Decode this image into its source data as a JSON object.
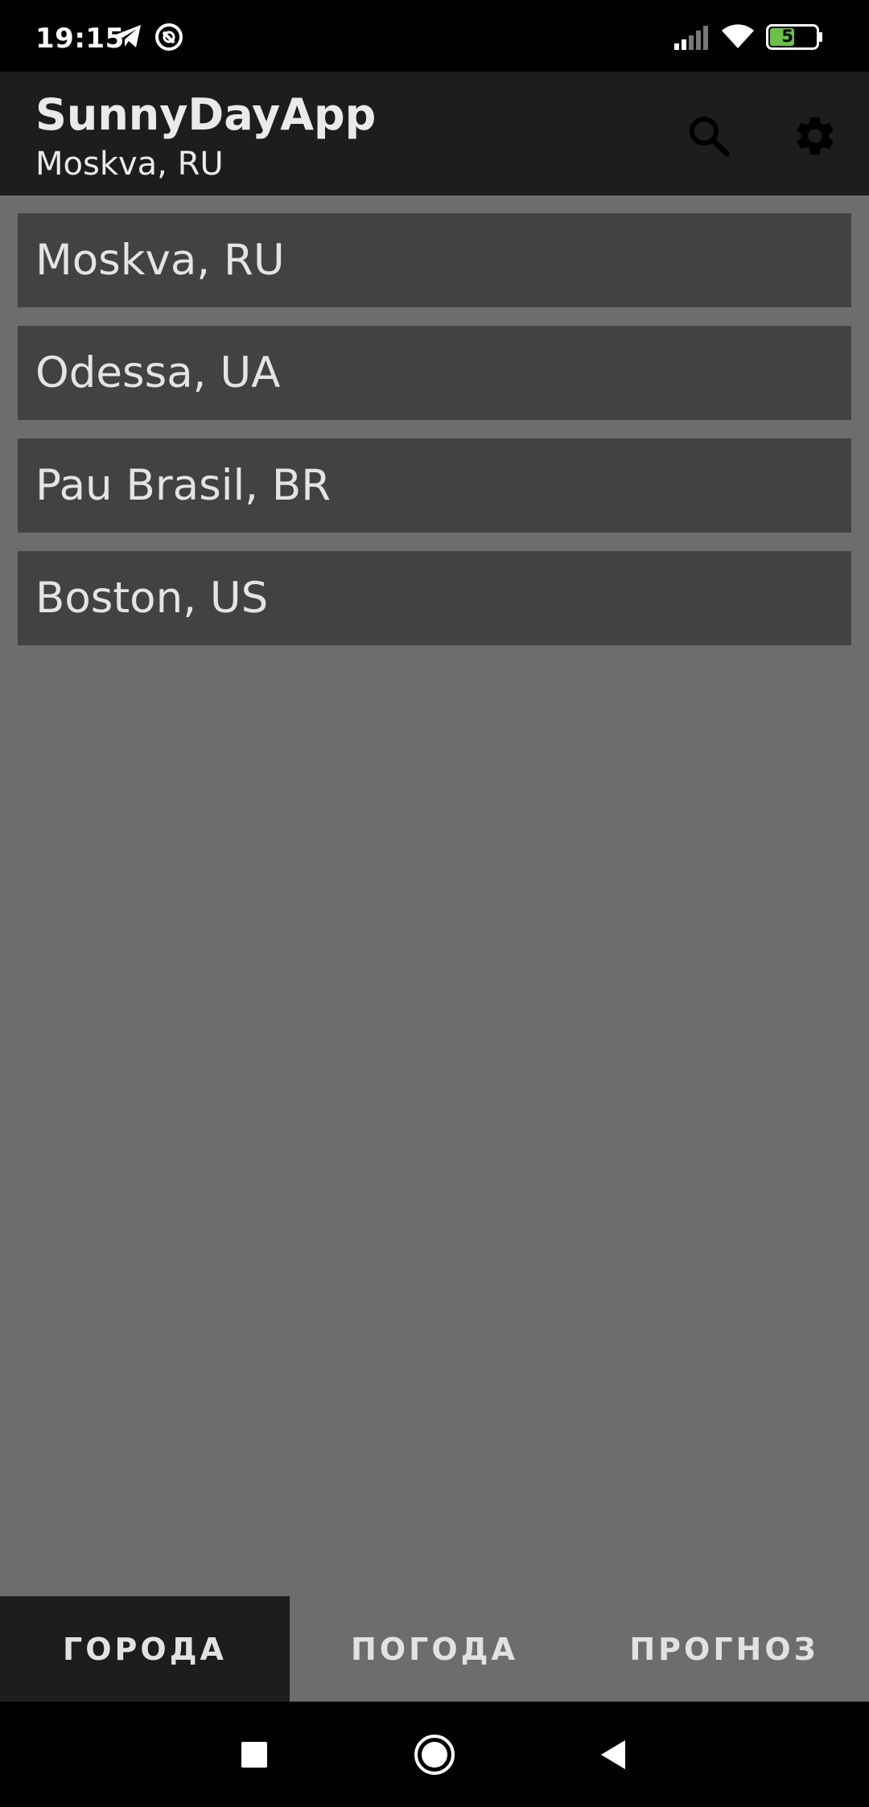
{
  "status_bar": {
    "time": "19:15",
    "left_icons": [
      "telegram-icon",
      "at-sign-icon"
    ],
    "right_icons": [
      "signal-icon",
      "wifi-icon",
      "battery-icon"
    ],
    "battery_level": "51"
  },
  "app_bar": {
    "title": "SunnyDayApp",
    "subtitle": "Moskva, RU",
    "actions": [
      "search-icon",
      "settings-icon"
    ]
  },
  "cities": [
    {
      "label": "Moskva, RU"
    },
    {
      "label": "Odessa, UA"
    },
    {
      "label": "Pau Brasil, BR"
    },
    {
      "label": "Boston, US"
    }
  ],
  "tabs": [
    {
      "label": "ГОРОДА",
      "active": true
    },
    {
      "label": "ПОГОДА",
      "active": false
    },
    {
      "label": "ПРОГНОЗ",
      "active": false
    }
  ],
  "nav_bar": {
    "buttons": [
      "recents-icon",
      "home-icon",
      "back-icon"
    ]
  },
  "colors": {
    "background": "#6d6d6d",
    "app_bar": "#1d1d1d",
    "list_item": "#424242",
    "battery_fill": "#6bc04b"
  }
}
